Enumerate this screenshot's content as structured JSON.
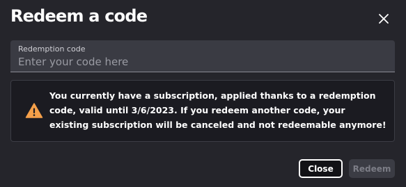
{
  "dialog": {
    "title": "Redeem a code",
    "close_icon": "close-icon"
  },
  "redemption_field": {
    "label": "Redemption code",
    "placeholder": "Enter your code here",
    "value": ""
  },
  "notice": {
    "icon": "warning-icon",
    "icon_color": "#f5a04a",
    "text": "You currently have a subscription, applied thanks to a redemption code, valid until 3/6/2023. If you redeem another code, your existing subscription will be canceled and not redeemable anymore!"
  },
  "actions": {
    "close_label": "Close",
    "redeem_label": "Redeem",
    "redeem_disabled": true
  },
  "colors": {
    "background": "#25252b",
    "field_background": "#3a3b43",
    "notice_background": "#1b1b21",
    "disabled_button": "#3b3c44"
  }
}
